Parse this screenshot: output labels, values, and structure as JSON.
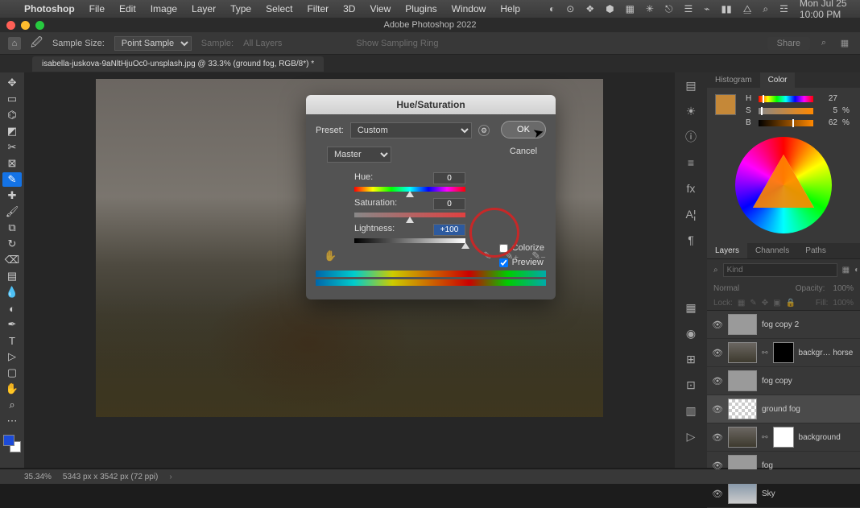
{
  "menubar": {
    "app": "Photoshop",
    "items": [
      "File",
      "Edit",
      "Image",
      "Layer",
      "Type",
      "Select",
      "Filter",
      "3D",
      "View",
      "Plugins",
      "Window",
      "Help"
    ],
    "clock": "Mon Jul 25  10:00 PM"
  },
  "titlebar": {
    "title": "Adobe Photoshop 2022"
  },
  "optbar": {
    "sample_size_label": "Sample Size:",
    "sample_size_value": "Point Sample",
    "sample_label": "Sample:",
    "sample_value": "All Layers",
    "sampling_ring": "Show Sampling Ring",
    "share": "Share"
  },
  "doctab": {
    "label": "isabella-juskova-9aNltHjuOc0-unsplash.jpg @ 33.3% (ground fog, RGB/8*) *"
  },
  "dialog": {
    "title": "Hue/Saturation",
    "preset_label": "Preset:",
    "preset_value": "Custom",
    "ok": "OK",
    "cancel": "Cancel",
    "channel": "Master",
    "hue_label": "Hue:",
    "hue_value": "0",
    "sat_label": "Saturation:",
    "sat_value": "0",
    "light_label": "Lightness:",
    "light_value": "+100",
    "colorize": "Colorize",
    "preview": "Preview"
  },
  "panel_tabs": {
    "histogram": "Histogram",
    "color": "Color"
  },
  "color_panel": {
    "h_label": "H",
    "h_val": "27",
    "s_label": "S",
    "s_val": "5",
    "s_pct": "%",
    "b_label": "B",
    "b_val": "62",
    "b_pct": "%"
  },
  "layer_tabs": {
    "layers": "Layers",
    "channels": "Channels",
    "paths": "Paths"
  },
  "layers_head": {
    "kind_placeholder": "Kind"
  },
  "layers_opts": {
    "blend": "Normal",
    "opacity_label": "Opacity:",
    "opacity_val": "100%",
    "lock": "Lock:",
    "fill_label": "Fill:",
    "fill_val": "100%"
  },
  "layers": [
    {
      "name": "fog copy 2",
      "thumb": "grey"
    },
    {
      "name": "backgr… horse",
      "thumb": "img",
      "mask": true
    },
    {
      "name": "fog copy",
      "thumb": "grey"
    },
    {
      "name": "ground fog",
      "thumb": "checker",
      "selected": true
    },
    {
      "name": "background",
      "thumb": "img",
      "mask": true,
      "maskwhite": true
    },
    {
      "name": "fog",
      "thumb": "grey"
    },
    {
      "name": "Sky",
      "thumb": "sky"
    }
  ],
  "statusbar": {
    "zoom": "35.34%",
    "dims": "5343 px x 3542 px (72 ppi)"
  }
}
